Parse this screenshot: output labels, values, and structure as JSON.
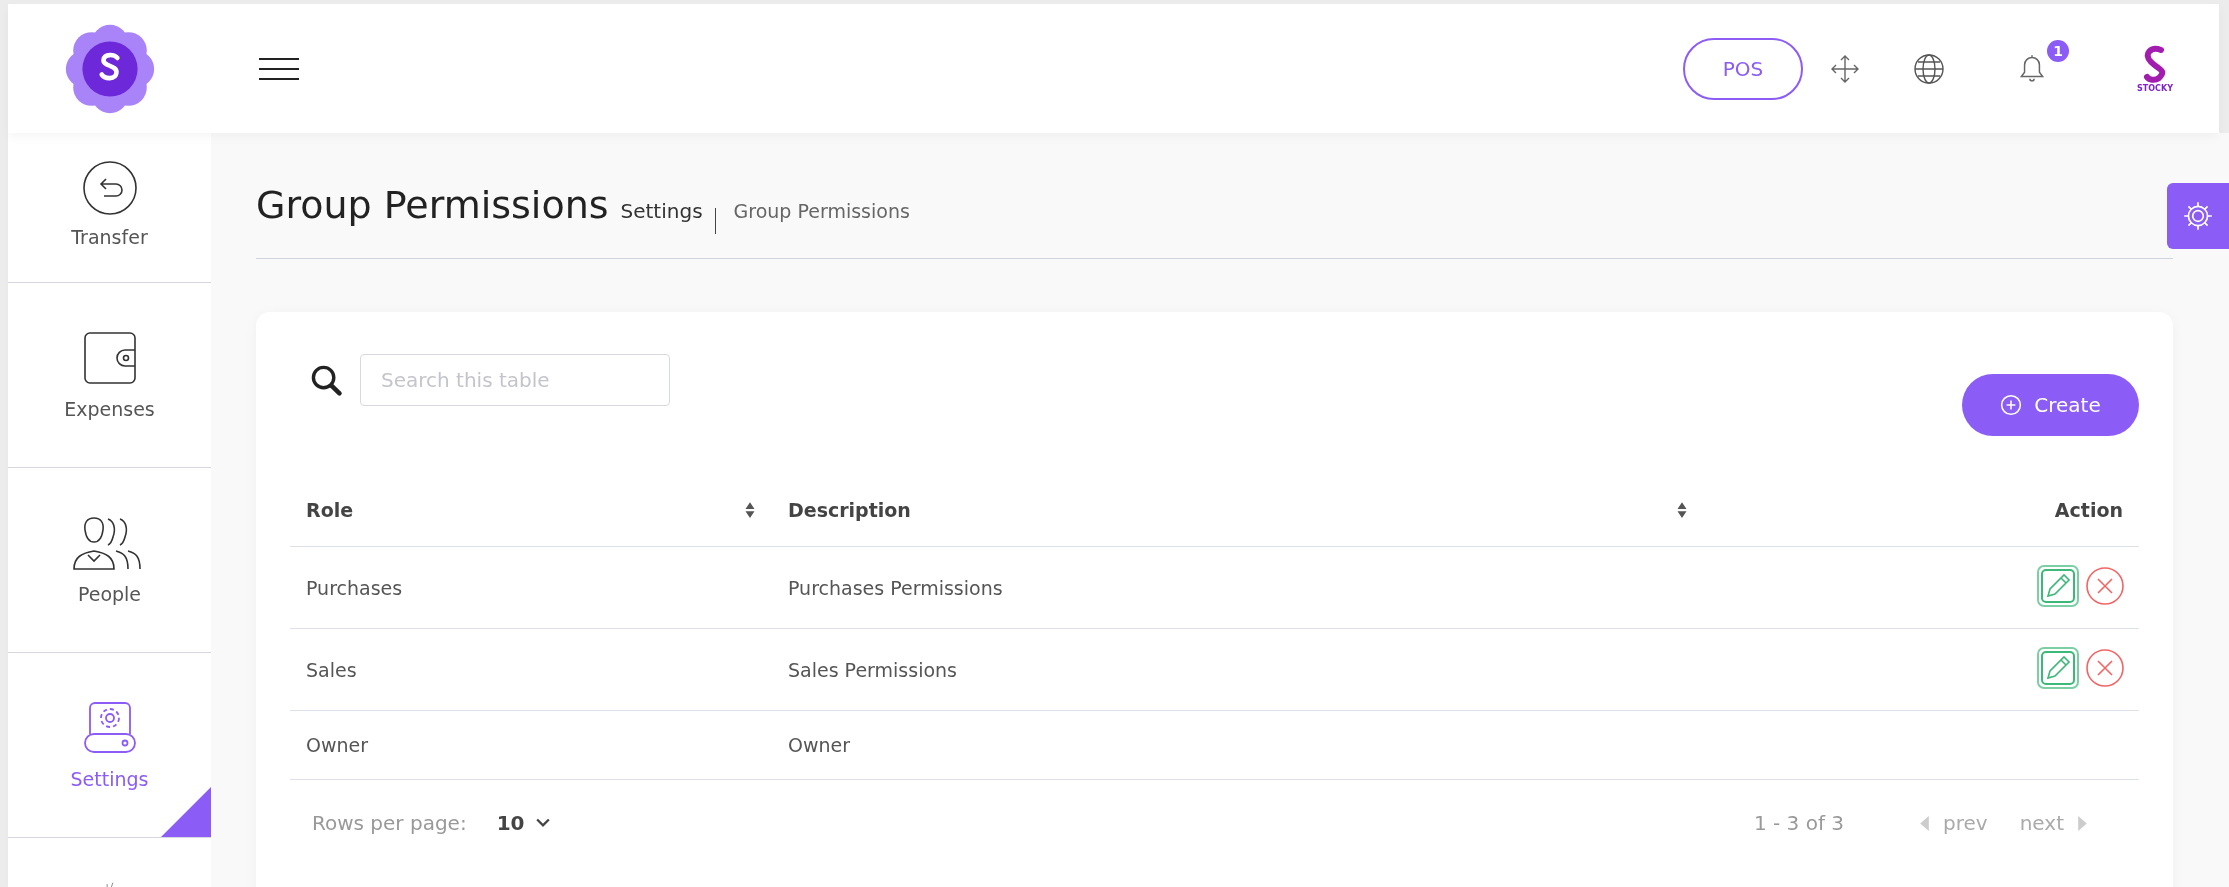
{
  "header": {
    "pos_button": "POS",
    "notifications_count": "1",
    "brand": "STOCKY"
  },
  "sidebar": {
    "items": [
      {
        "kind": "transfer",
        "label": "Transfer",
        "selected": false
      },
      {
        "kind": "wallet",
        "label": "Expenses",
        "selected": false
      },
      {
        "kind": "people",
        "label": "People",
        "selected": false
      },
      {
        "kind": "settings",
        "label": "Settings",
        "selected": true
      },
      {
        "kind": "other",
        "selected": false
      }
    ]
  },
  "page": {
    "title": "Group Permissions",
    "breadcrumb": [
      "Settings",
      "Group Permissions"
    ]
  },
  "search": {
    "placeholder": "Search this table"
  },
  "create_button": "Create",
  "table": {
    "columns": [
      {
        "label": "Role",
        "sortable": true
      },
      {
        "label": "Description",
        "sortable": true
      },
      {
        "label": "Action",
        "sortable": false
      }
    ],
    "rows": [
      {
        "role": "Purchases",
        "description": "Purchases Permissions",
        "actions": true
      },
      {
        "role": "Sales",
        "description": "Sales Permissions",
        "actions": true
      },
      {
        "role": "Owner",
        "description": "Owner",
        "actions": false
      }
    ]
  },
  "pagination": {
    "rows_per_page_label": "Rows per page:",
    "rows_per_page": "10",
    "range": "1 - 3 of 3",
    "prev": "prev",
    "next": "next"
  }
}
